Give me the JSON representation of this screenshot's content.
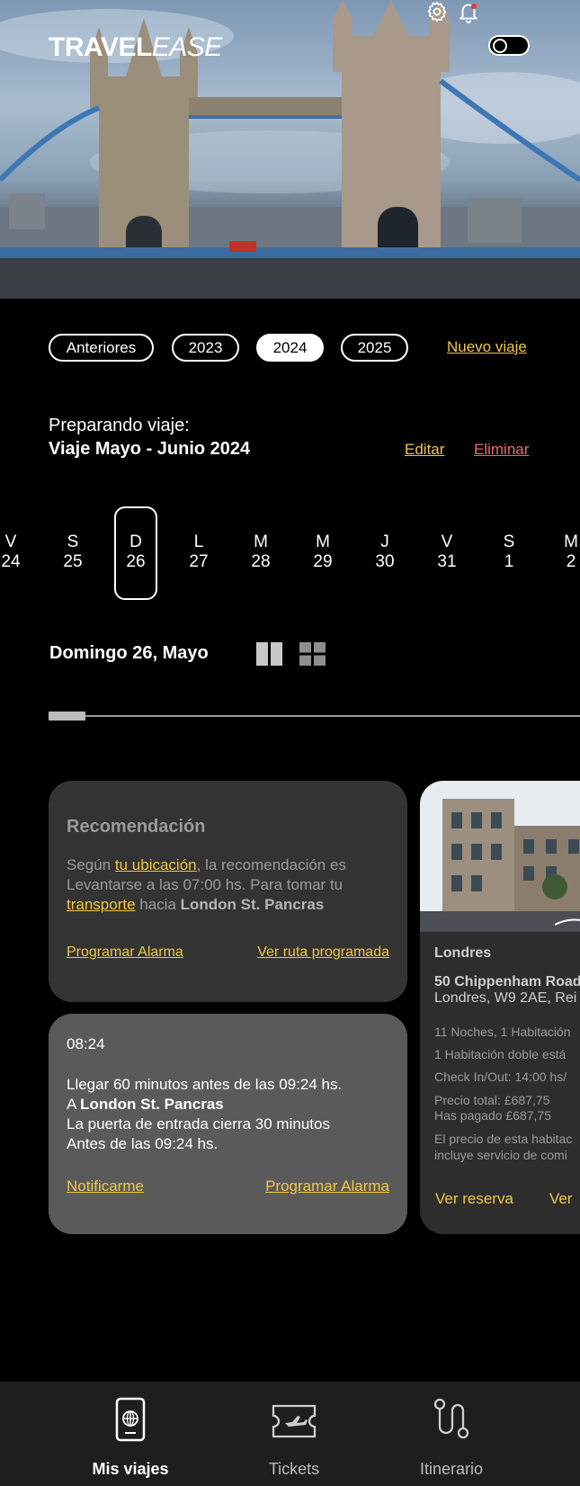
{
  "brand": {
    "bold": "TRAVEL",
    "italic": "EASE"
  },
  "header": {
    "settings_icon": "gear-icon",
    "notification_icon": "bell-icon",
    "theme_toggle": "toggle-switch"
  },
  "filters": {
    "chips": [
      {
        "label": "Anteriores",
        "active": false
      },
      {
        "label": "2023",
        "active": false
      },
      {
        "label": "2024",
        "active": true
      },
      {
        "label": "2025",
        "active": false
      }
    ],
    "new_trip": "Nuevo viaje"
  },
  "trip": {
    "preparing": "Preparando viaje:",
    "name": "Viaje Mayo - Junio 2024",
    "edit": "Editar",
    "delete": "Eliminar"
  },
  "calendar": {
    "days": [
      {
        "letter": "V",
        "num": "24"
      },
      {
        "letter": "S",
        "num": "25"
      },
      {
        "letter": "D",
        "num": "26",
        "selected": true
      },
      {
        "letter": "L",
        "num": "27"
      },
      {
        "letter": "M",
        "num": "28"
      },
      {
        "letter": "M",
        "num": "29"
      },
      {
        "letter": "J",
        "num": "30"
      },
      {
        "letter": "V",
        "num": "31"
      },
      {
        "letter": "S",
        "num": "1"
      },
      {
        "letter": "M",
        "num": "2"
      }
    ]
  },
  "selected_date": "Domingo 26, Mayo",
  "view_icons": [
    "columns-view-icon",
    "grid-view-icon"
  ],
  "carousel_progress": 0.07,
  "recommendation": {
    "title": "Recomendación",
    "t1": "Según ",
    "link1": "tu ubicación",
    "t2": ", la recomendación es Levantarse a las 07:00 hs. Para tomar tu ",
    "link2": "transporte",
    "t3": " hacia ",
    "place": "London St. Pancras",
    "action1": "Programar Alarma",
    "action2": "Ver ruta programada"
  },
  "reminder": {
    "time": "08:24",
    "line1": "Llegar 60 minutos antes de las 09:24 hs.",
    "line2_pre": "A ",
    "line2_place": "London St. Pancras",
    "line3": "La puerta de entrada cierra 30 minutos",
    "line4": "Antes de las 09:24 hs.",
    "action1": "Notificarme",
    "action2": "Programar Alarma"
  },
  "hotel": {
    "city": "Londres",
    "address": "50 Chippenham Road",
    "address2": "Londres, W9 2AE, Rei",
    "nights": "11 Noches, 1 Habitación",
    "room": "1 Habitación doble está",
    "checkin": "Check In/Out: 14:00 hs/",
    "price_total": "Precio total: £687,75",
    "paid": "Has pagado £687,75",
    "note1": "El precio de esta habitac",
    "note2": "incluye servicio de comi",
    "action1": "Ver reserva",
    "action2": "Ver"
  },
  "nav": [
    {
      "label": "Mis viajes",
      "icon": "passport-icon",
      "active": true
    },
    {
      "label": "Tickets",
      "icon": "ticket-icon",
      "active": false
    },
    {
      "label": "Itinerario",
      "icon": "route-icon",
      "active": false
    }
  ]
}
